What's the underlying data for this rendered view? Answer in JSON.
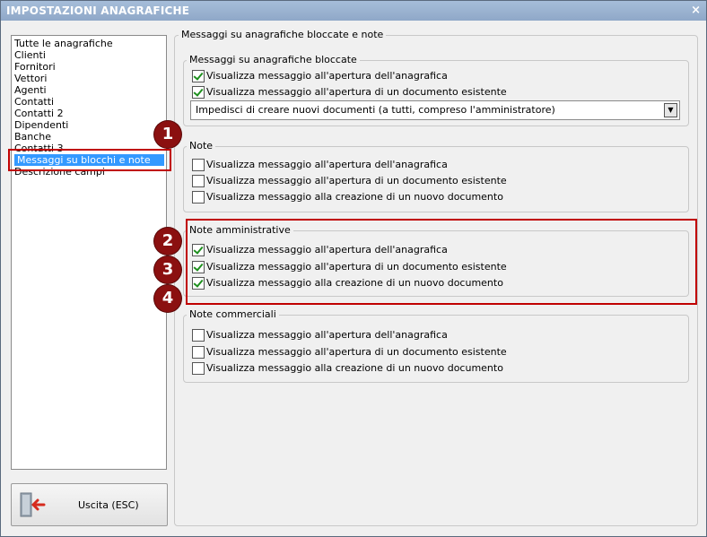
{
  "window": {
    "title": "IMPOSTAZIONI ANAGRAFICHE",
    "close_glyph": "×"
  },
  "sidebar": {
    "items": [
      "Tutte le anagrafiche",
      "Clienti",
      "Fornitori",
      "Vettori",
      "Agenti",
      "Contatti",
      "Contatti 2",
      "Dipendenti",
      "Banche",
      "Contatti 3",
      "Messaggi su blocchi e note",
      "Descrizione campi"
    ],
    "selected_index": 10
  },
  "exit_button": {
    "label": "Uscita (ESC)",
    "icon": "exit-door-icon"
  },
  "main": {
    "group_title": "Messaggi su anagrafiche bloccate e note",
    "blocked": {
      "title": "Messaggi su anagrafiche bloccate",
      "options": [
        {
          "label": "Visualizza messaggio all'apertura dell'anagrafica",
          "checked": true
        },
        {
          "label": "Visualizza messaggio all'apertura di un documento esistente",
          "checked": true
        }
      ],
      "combo_value": "Impedisci di creare nuovi documenti (a tutti, compreso l'amministratore)"
    },
    "note": {
      "title": "Note",
      "options": [
        {
          "label": "Visualizza messaggio all'apertura dell'anagrafica",
          "checked": false
        },
        {
          "label": "Visualizza messaggio all'apertura di un documento esistente",
          "checked": false
        },
        {
          "label": "Visualizza messaggio alla creazione di un nuovo documento",
          "checked": false
        }
      ]
    },
    "note_amministrative": {
      "title": "Note amministrative",
      "options": [
        {
          "label": "Visualizza messaggio all'apertura dell'anagrafica",
          "checked": true
        },
        {
          "label": "Visualizza messaggio all'apertura di un documento esistente",
          "checked": true
        },
        {
          "label": "Visualizza messaggio alla creazione di un nuovo documento",
          "checked": true
        }
      ]
    },
    "note_commerciali": {
      "title": "Note commerciali",
      "options": [
        {
          "label": "Visualizza messaggio all'apertura dell'anagrafica",
          "checked": false
        },
        {
          "label": "Visualizza messaggio all'apertura di un documento esistente",
          "checked": false
        },
        {
          "label": "Visualizza messaggio alla creazione di un nuovo documento",
          "checked": false
        }
      ]
    }
  },
  "callouts": [
    "1",
    "2",
    "3",
    "4"
  ],
  "colors": {
    "titlebar": "#8fa8c8",
    "selection": "#3399ff",
    "callout": "#8b1010",
    "highlight": "#c00000",
    "check": "#1d8f1d"
  }
}
